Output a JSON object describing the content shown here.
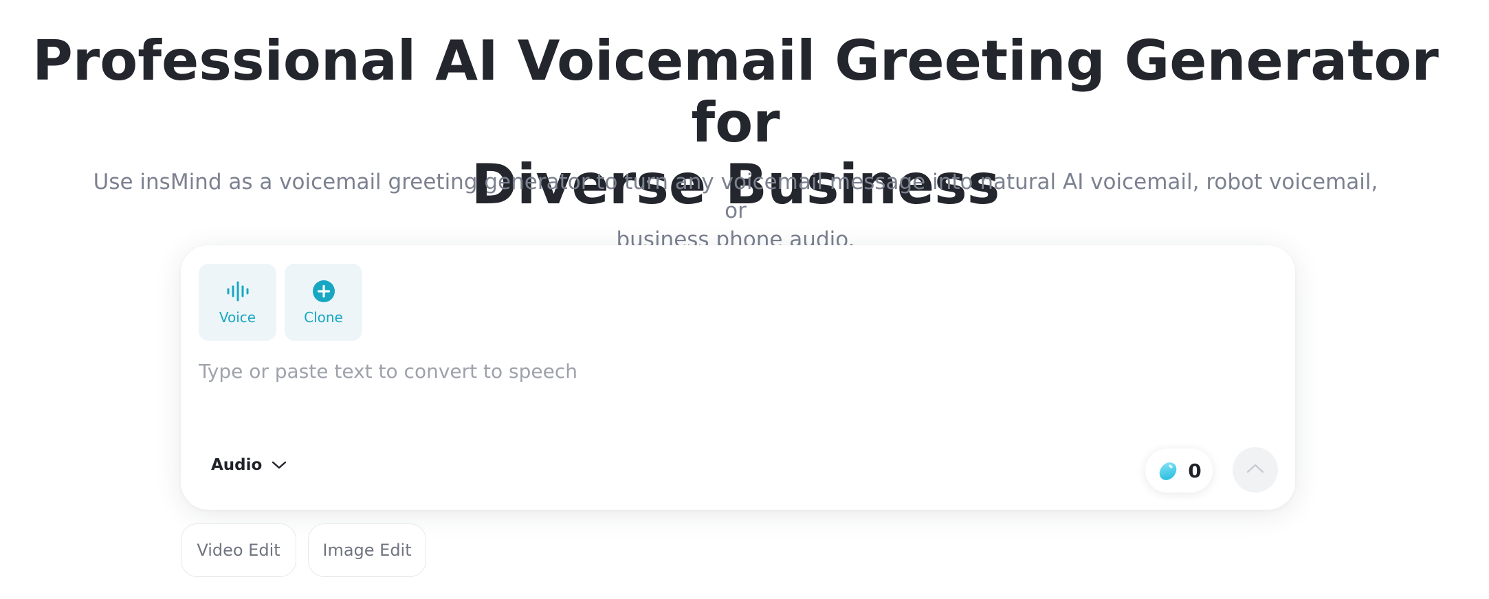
{
  "hero": {
    "title_line1": "Professional AI Voicemail Greeting Generator for",
    "title_line2": "Diverse Business",
    "subtitle_line1": "Use insMind as a voicemail greeting generator to turn any voicemail message into natural AI voicemail, robot voicemail, or",
    "subtitle_line2": "business phone audio."
  },
  "editor": {
    "tools": [
      {
        "label": "Voice",
        "icon": "soundwave-icon"
      },
      {
        "label": "Clone",
        "icon": "plus-circle-icon"
      }
    ],
    "input": {
      "value": "",
      "placeholder": "Type or paste text to convert to speech"
    },
    "mode": {
      "selected": "Audio",
      "icon": "chevron-down-icon"
    },
    "credits": {
      "count": "0",
      "icon": "credit-bean-icon"
    },
    "submit": {
      "icon": "chevron-up-icon"
    }
  },
  "chips": [
    {
      "label": "Video Edit"
    },
    {
      "label": "Image Edit"
    }
  ],
  "colors": {
    "accent": "#18a7c2",
    "tool_bg": "#edf5f8",
    "title": "#23262c",
    "subtitle": "#7b8190",
    "placeholder": "#9ea2ab"
  }
}
